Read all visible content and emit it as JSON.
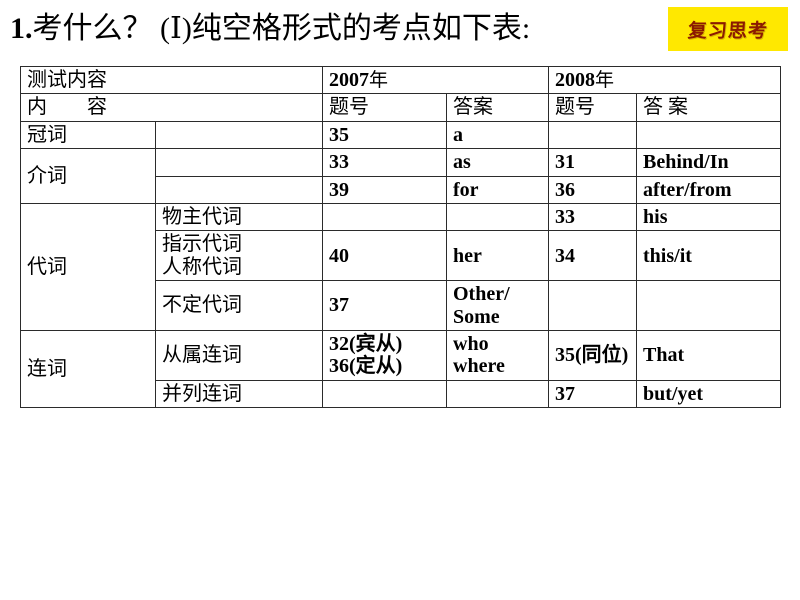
{
  "slide": {
    "title_number": "1.",
    "title_text": "考什么？ (Ⅰ)纯空格形式的考点如下表:",
    "badge_label": "复习思考",
    "badge_bg": "#FFE800",
    "badge_fg": "#8B1A00"
  },
  "table": {
    "header_row1": {
      "content_label": "测试内容",
      "year_2007": "2007年",
      "year_2008": "2008年"
    },
    "header_row2": {
      "content_label": "内　　容",
      "sub_blank": "",
      "q2007": "题号",
      "a2007": "答案",
      "q2008": "题号",
      "a2008": "答 案"
    },
    "rows": [
      {
        "category": "冠词",
        "subcategory": "",
        "q2007": "35",
        "a2007": "a",
        "q2008": "",
        "a2008": ""
      },
      {
        "category": "介词",
        "subcategory": "",
        "q2007": "33",
        "a2007": "as",
        "q2008": "31",
        "a2008": "Behind/In"
      },
      {
        "category": "",
        "subcategory": "",
        "q2007": "39",
        "a2007": "for",
        "q2008": "36",
        "a2008": "after/from"
      },
      {
        "category": "代词",
        "subcategory": "物主代词",
        "q2007": "",
        "a2007": "",
        "q2008": "33",
        "a2008": "his"
      },
      {
        "category": "",
        "subcategory": "指示代词\n人称代词",
        "q2007": "40",
        "a2007": "her",
        "q2008": "34",
        "a2008": "this/it"
      },
      {
        "category": "",
        "subcategory": "不定代词",
        "q2007": "37",
        "a2007": "Other/\nSome",
        "q2008": "",
        "a2008": ""
      },
      {
        "category": "连词",
        "subcategory": "从属连词",
        "q2007": "32(宾从)\n36(定从)",
        "a2007": "who\nwhere",
        "q2008": "35(同位)",
        "a2008": "That"
      },
      {
        "category": "",
        "subcategory": "并列连词",
        "q2007": "",
        "a2007": "",
        "q2008": "37",
        "a2008": "but/yet"
      }
    ]
  }
}
